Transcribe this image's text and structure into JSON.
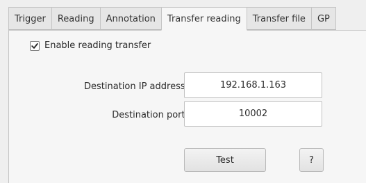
{
  "tabs": [
    {
      "label": "Trigger",
      "active": false
    },
    {
      "label": "Reading",
      "active": false
    },
    {
      "label": "Annotation",
      "active": false
    },
    {
      "label": "Transfer reading",
      "active": true
    },
    {
      "label": "Transfer file",
      "active": false
    },
    {
      "label": "GP",
      "active": false
    }
  ],
  "transfer": {
    "enable_label": "Enable reading transfer",
    "enable_checked": true,
    "ip_label": "Destination IP address:",
    "ip_value": "192.168.1.163",
    "port_label": "Destination port:",
    "port_value": "10002",
    "test_label": "Test",
    "help_label": "?"
  }
}
